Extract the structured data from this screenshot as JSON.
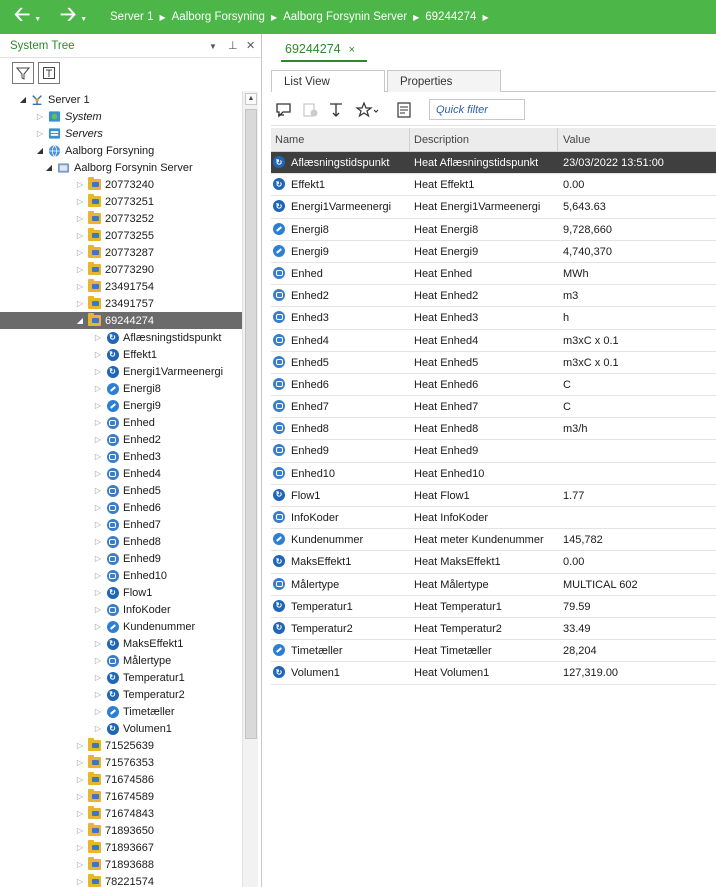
{
  "topbar": {
    "back_icon": "arrow-left-icon",
    "forward_icon": "arrow-right-icon",
    "breadcrumbs": [
      "Server 1",
      "Aalborg Forsyning",
      "Aalborg Forsynin Server",
      "69244274"
    ],
    "background": "#4cb648"
  },
  "left_pane": {
    "title": "System Tree",
    "controls": {
      "dropdown": "▼",
      "pin": "⊥",
      "close": "✕"
    },
    "tools": [
      "filter-icon",
      "collapse-icon"
    ]
  },
  "tree": [
    {
      "label": "Server 1",
      "level": 0,
      "icon": "server-icon",
      "expander": "open"
    },
    {
      "label": "System",
      "level": 1,
      "icon": "system-icon",
      "expander": "closed",
      "italic": true
    },
    {
      "label": "Servers",
      "level": 1,
      "icon": "servers-icon",
      "expander": "closed",
      "italic": true
    },
    {
      "label": "Aalborg Forsyning",
      "level": 1,
      "icon": "globe-icon",
      "expander": "open"
    },
    {
      "label": "Aalborg Forsynin Server",
      "level": 2,
      "icon": "server-box-icon",
      "expander": "open"
    },
    {
      "label": "20773240",
      "level": 3,
      "icon": "folder-icon",
      "expander": "closed"
    },
    {
      "label": "20773251",
      "level": 3,
      "icon": "folder-icon",
      "expander": "closed"
    },
    {
      "label": "20773252",
      "level": 3,
      "icon": "folder-icon",
      "expander": "closed"
    },
    {
      "label": "20773255",
      "level": 3,
      "icon": "folder-icon",
      "expander": "closed"
    },
    {
      "label": "20773287",
      "level": 3,
      "icon": "folder-icon",
      "expander": "closed"
    },
    {
      "label": "20773290",
      "level": 3,
      "icon": "folder-icon",
      "expander": "closed"
    },
    {
      "label": "23491754",
      "level": 3,
      "icon": "folder-icon",
      "expander": "closed"
    },
    {
      "label": "23491757",
      "level": 3,
      "icon": "folder-icon",
      "expander": "closed"
    },
    {
      "label": "69244274",
      "level": 3,
      "icon": "folder-icon",
      "expander": "open",
      "selected": true
    },
    {
      "label": "Aflæsningstidspunkt",
      "level": 4,
      "icon": "refresh-icon",
      "expander": "closed"
    },
    {
      "label": "Effekt1",
      "level": 4,
      "icon": "refresh-icon",
      "expander": "closed"
    },
    {
      "label": "Energi1Varmeenergi",
      "level": 4,
      "icon": "refresh-icon",
      "expander": "closed"
    },
    {
      "label": "Energi8",
      "level": 4,
      "icon": "dial-icon",
      "expander": "closed"
    },
    {
      "label": "Energi9",
      "level": 4,
      "icon": "dial-icon",
      "expander": "closed"
    },
    {
      "label": "Enhed",
      "level": 4,
      "icon": "database-icon",
      "expander": "closed"
    },
    {
      "label": "Enhed2",
      "level": 4,
      "icon": "database-icon",
      "expander": "closed"
    },
    {
      "label": "Enhed3",
      "level": 4,
      "icon": "database-icon",
      "expander": "closed"
    },
    {
      "label": "Enhed4",
      "level": 4,
      "icon": "database-icon",
      "expander": "closed"
    },
    {
      "label": "Enhed5",
      "level": 4,
      "icon": "database-icon",
      "expander": "closed"
    },
    {
      "label": "Enhed6",
      "level": 4,
      "icon": "database-icon",
      "expander": "closed"
    },
    {
      "label": "Enhed7",
      "level": 4,
      "icon": "database-icon",
      "expander": "closed"
    },
    {
      "label": "Enhed8",
      "level": 4,
      "icon": "database-icon",
      "expander": "closed"
    },
    {
      "label": "Enhed9",
      "level": 4,
      "icon": "database-icon",
      "expander": "closed"
    },
    {
      "label": "Enhed10",
      "level": 4,
      "icon": "database-icon",
      "expander": "closed"
    },
    {
      "label": "Flow1",
      "level": 4,
      "icon": "refresh-icon",
      "expander": "closed"
    },
    {
      "label": "InfoKoder",
      "level": 4,
      "icon": "database-icon",
      "expander": "closed"
    },
    {
      "label": "Kundenummer",
      "level": 4,
      "icon": "dial-icon",
      "expander": "closed"
    },
    {
      "label": "MaksEffekt1",
      "level": 4,
      "icon": "refresh-icon",
      "expander": "closed"
    },
    {
      "label": "Målertype",
      "level": 4,
      "icon": "database-icon",
      "expander": "closed"
    },
    {
      "label": "Temperatur1",
      "level": 4,
      "icon": "refresh-icon",
      "expander": "closed"
    },
    {
      "label": "Temperatur2",
      "level": 4,
      "icon": "refresh-icon",
      "expander": "closed"
    },
    {
      "label": "Timetæller",
      "level": 4,
      "icon": "dial-icon",
      "expander": "closed"
    },
    {
      "label": "Volumen1",
      "level": 4,
      "icon": "refresh-icon",
      "expander": "closed"
    },
    {
      "label": "71525639",
      "level": 3,
      "icon": "folder-icon",
      "expander": "closed"
    },
    {
      "label": "71576353",
      "level": 3,
      "icon": "folder-icon",
      "expander": "closed"
    },
    {
      "label": "71674586",
      "level": 3,
      "icon": "folder-icon",
      "expander": "closed"
    },
    {
      "label": "71674589",
      "level": 3,
      "icon": "folder-icon",
      "expander": "closed"
    },
    {
      "label": "71674843",
      "level": 3,
      "icon": "folder-icon",
      "expander": "closed"
    },
    {
      "label": "71893650",
      "level": 3,
      "icon": "folder-icon",
      "expander": "closed"
    },
    {
      "label": "71893667",
      "level": 3,
      "icon": "folder-icon",
      "expander": "closed"
    },
    {
      "label": "71893688",
      "level": 3,
      "icon": "folder-icon",
      "expander": "closed"
    },
    {
      "label": "78221574",
      "level": 3,
      "icon": "folder-icon",
      "expander": "closed"
    }
  ],
  "right_pane": {
    "doc_tab": {
      "label": "69244274",
      "close": "×"
    },
    "subtabs": [
      {
        "label": "List View",
        "active": true
      },
      {
        "label": "Properties",
        "active": false
      }
    ],
    "toolbar": {
      "icons": [
        "chat-icon",
        "add-item-icon",
        "sort-icon",
        "favorite-star-icon",
        "export-icon"
      ],
      "quick_filter_placeholder": "Quick filter"
    },
    "columns": [
      "Name",
      "Description",
      "Value"
    ],
    "rows": [
      {
        "name": "Aflæsningstidspunkt",
        "description": "Heat Aflæsningstidspunkt",
        "value": "23/03/2022 13:51:00",
        "icon": "refresh-icon",
        "selected": true
      },
      {
        "name": "Effekt1",
        "description": "Heat Effekt1",
        "value": "0.00",
        "icon": "refresh-icon"
      },
      {
        "name": "Energi1Varmeenergi",
        "description": "Heat Energi1Varmeenergi",
        "value": "5,643.63",
        "icon": "refresh-icon"
      },
      {
        "name": "Energi8",
        "description": "Heat Energi8",
        "value": "9,728,660",
        "icon": "dial-icon"
      },
      {
        "name": "Energi9",
        "description": "Heat Energi9",
        "value": "4,740,370",
        "icon": "dial-icon"
      },
      {
        "name": "Enhed",
        "description": "Heat Enhed",
        "value": "MWh",
        "icon": "database-icon"
      },
      {
        "name": "Enhed2",
        "description": "Heat Enhed2",
        "value": "m3",
        "icon": "database-icon"
      },
      {
        "name": "Enhed3",
        "description": "Heat Enhed3",
        "value": "h",
        "icon": "database-icon"
      },
      {
        "name": "Enhed4",
        "description": "Heat Enhed4",
        "value": "m3xC x 0.1",
        "icon": "database-icon"
      },
      {
        "name": "Enhed5",
        "description": "Heat Enhed5",
        "value": "m3xC x 0.1",
        "icon": "database-icon"
      },
      {
        "name": "Enhed6",
        "description": "Heat Enhed6",
        "value": "C",
        "icon": "database-icon"
      },
      {
        "name": "Enhed7",
        "description": "Heat Enhed7",
        "value": "C",
        "icon": "database-icon"
      },
      {
        "name": "Enhed8",
        "description": "Heat Enhed8",
        "value": "m3/h",
        "icon": "database-icon"
      },
      {
        "name": "Enhed9",
        "description": "Heat Enhed9",
        "value": "",
        "icon": "database-icon"
      },
      {
        "name": "Enhed10",
        "description": "Heat Enhed10",
        "value": "",
        "icon": "database-icon"
      },
      {
        "name": "Flow1",
        "description": "Heat Flow1",
        "value": "1.77",
        "icon": "refresh-icon"
      },
      {
        "name": "InfoKoder",
        "description": "Heat InfoKoder",
        "value": "",
        "icon": "database-icon"
      },
      {
        "name": "Kundenummer",
        "description": "Heat meter Kundenummer",
        "value": "145,782",
        "icon": "dial-icon"
      },
      {
        "name": "MaksEffekt1",
        "description": "Heat MaksEffekt1",
        "value": "0.00",
        "icon": "refresh-icon"
      },
      {
        "name": "Målertype",
        "description": "Heat Målertype",
        "value": "MULTICAL 602",
        "icon": "database-icon"
      },
      {
        "name": "Temperatur1",
        "description": "Heat Temperatur1",
        "value": "79.59",
        "icon": "refresh-icon"
      },
      {
        "name": "Temperatur2",
        "description": "Heat Temperatur2",
        "value": "33.49",
        "icon": "refresh-icon"
      },
      {
        "name": "Timetæller",
        "description": "Heat Timetæller",
        "value": "28,204",
        "icon": "dial-icon"
      },
      {
        "name": "Volumen1",
        "description": "Heat Volumen1",
        "value": "127,319.00",
        "icon": "refresh-icon"
      }
    ]
  },
  "colors": {
    "accent_green": "#2c8a2c",
    "selected_row": "#3f3f3f",
    "selected_tree": "#6b6b6b"
  }
}
